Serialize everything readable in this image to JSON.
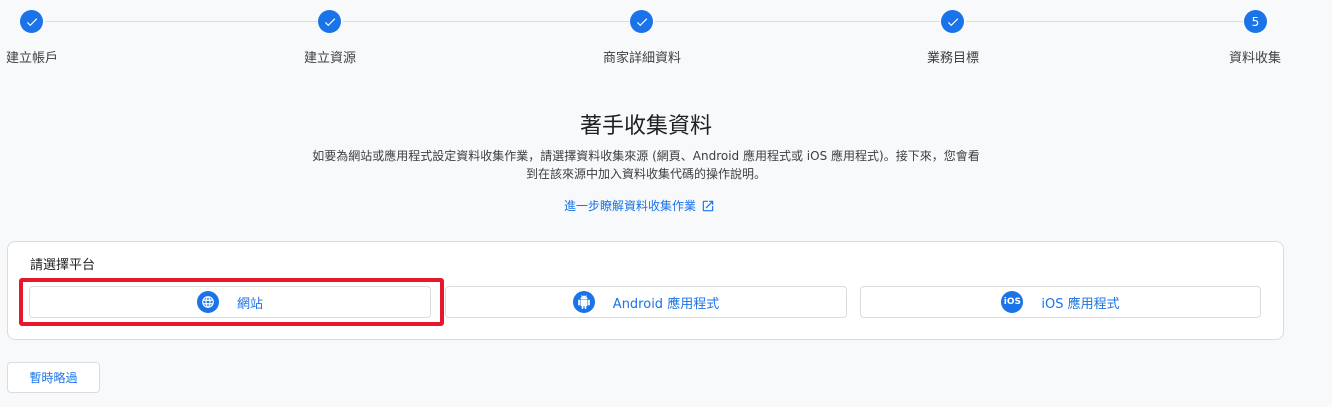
{
  "stepper": {
    "steps": [
      {
        "label": "建立帳戶",
        "state": "done"
      },
      {
        "label": "建立資源",
        "state": "done"
      },
      {
        "label": "商家詳細資料",
        "state": "done"
      },
      {
        "label": "業務目標",
        "state": "done"
      },
      {
        "label": "資料收集",
        "state": "current",
        "number": "5"
      }
    ]
  },
  "main": {
    "title": "著手收集資料",
    "description_line1": "如要為網站或應用程式設定資料收集作業，請選擇資料收集來源 (網頁、Android 應用程式或 iOS 應用程式)。接下來，您會看",
    "description_line2": "到在該來源中加入資料收集代碼的操作說明。",
    "learn_more": "進一步瞭解資料收集作業"
  },
  "platform": {
    "title": "請選擇平台",
    "options": [
      {
        "label": "網站",
        "icon": "globe-icon"
      },
      {
        "label": "Android 應用程式",
        "icon": "android-icon"
      },
      {
        "label": "iOS 應用程式",
        "icon": "ios-icon",
        "icon_text": "iOS"
      }
    ]
  },
  "footer": {
    "skip_label": "暫時略過"
  },
  "colors": {
    "accent": "#1a73e8",
    "highlight": "#e8182c"
  }
}
